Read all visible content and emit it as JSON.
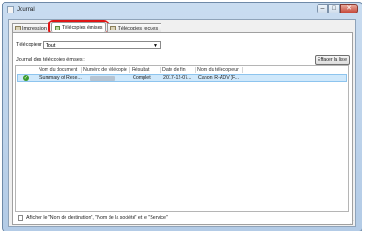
{
  "window": {
    "title": "Journal",
    "minimize": "–",
    "maximize": "□",
    "close": "✕"
  },
  "tabs": [
    {
      "label": "Impression",
      "icon": "printer-icon",
      "active": false
    },
    {
      "label": "Télécopies émises",
      "icon": "fax-sent-icon",
      "active": true
    },
    {
      "label": "Télécopies reçues",
      "icon": "fax-received-icon",
      "active": false
    }
  ],
  "filter": {
    "label": "Télécopieur :",
    "value": "Tout"
  },
  "journal_label": "Journal des télécopies émises :",
  "clear_button": "Effacer la liste",
  "table": {
    "columns": [
      "Nom du document",
      "Numéro de télécopie",
      "Résultat",
      "Date de fin",
      "Nom du télécopieur"
    ],
    "rows": [
      {
        "status_icon": "success-check-icon",
        "document": "Summary of Rese...",
        "fax_number": "",
        "result": "Complet",
        "end_date": "2017-12-07...",
        "fax_name": "Canon iR-ADV (F..."
      }
    ]
  },
  "show_details_checkbox": {
    "label": "Afficher le \"Nom de destination\", \"Nom de la société\" et le \"Service\"",
    "checked": false
  },
  "colors": {
    "selected_row": "#cfe8fb",
    "highlight_outline": "#e01414",
    "success": "#3a9a2a"
  }
}
